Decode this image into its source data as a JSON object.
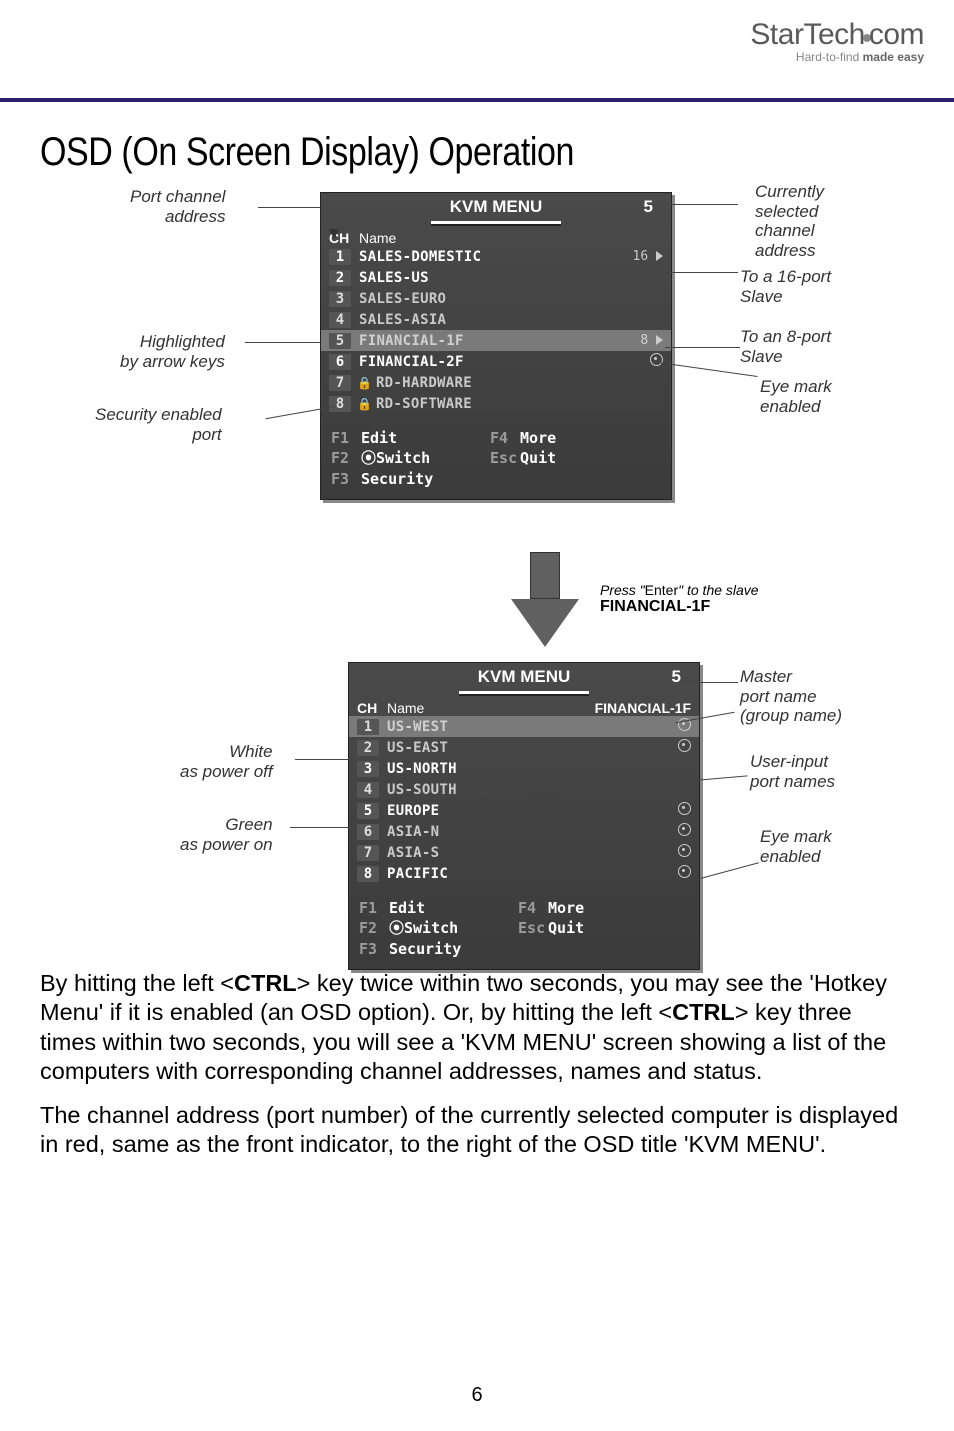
{
  "brand": {
    "name1": "StarTech",
    "name2": "com",
    "tag_pre": "Hard-to-find ",
    "tag_bold": "made easy"
  },
  "heading": "OSD (On Screen Display) Operation",
  "menu1": {
    "title": "KVM MENU",
    "current": "5",
    "ch_label": "CH",
    "name_label": "Name",
    "rows": [
      {
        "ch": "1",
        "name": "SALES-DOMESTIC",
        "ind": "16",
        "tri": true,
        "on": true
      },
      {
        "ch": "2",
        "name": "SALES-US",
        "on": true
      },
      {
        "ch": "3",
        "name": "SALES-EURO"
      },
      {
        "ch": "4",
        "name": "SALES-ASIA"
      },
      {
        "ch": "5",
        "name": "FINANCIAL-1F",
        "ind": "8",
        "tri": true,
        "hl": true
      },
      {
        "ch": "6",
        "name": "FINANCIAL-2F",
        "eye": true,
        "on": true
      },
      {
        "ch": "7",
        "name": "RD-HARDWARE",
        "lock": true
      },
      {
        "ch": "8",
        "name": "RD-SOFTWARE",
        "lock": true
      }
    ],
    "foot": {
      "f1": "F1",
      "f1l": "Edit",
      "f2": "F2",
      "f2l": "⦿Switch",
      "f3": "F3",
      "f3l": "Security",
      "f4": "F4",
      "f4l": "More",
      "esc": "Esc",
      "escl": "Quit"
    }
  },
  "menu2": {
    "title": "KVM MENU",
    "current": "5",
    "ch_label": "CH",
    "name_label": "Name",
    "group": "FINANCIAL-1F",
    "rows": [
      {
        "ch": "1",
        "name": "US-WEST",
        "eye": true,
        "hl": true
      },
      {
        "ch": "2",
        "name": "US-EAST",
        "eye": true
      },
      {
        "ch": "3",
        "name": "US-NORTH",
        "on": true
      },
      {
        "ch": "4",
        "name": "US-SOUTH"
      },
      {
        "ch": "5",
        "name": "EUROPE",
        "eye": true,
        "on": true
      },
      {
        "ch": "6",
        "name": "ASIA-N",
        "eye": true
      },
      {
        "ch": "7",
        "name": "ASIA-S",
        "eye": true
      },
      {
        "ch": "8",
        "name": "PACIFIC",
        "eye": true,
        "on": true
      }
    ],
    "foot": {
      "f1": "F1",
      "f1l": "Edit",
      "f2": "F2",
      "f2l": "⦿Switch",
      "f3": "F3",
      "f3l": "Security",
      "f4": "F4",
      "f4l": "More",
      "esc": "Esc",
      "escl": "Quit"
    }
  },
  "callouts": {
    "port_channel": "Port channel\naddress",
    "highlighted": "Highlighted\nby arrow keys",
    "security": "Security enabled\nport",
    "current_sel": "Currently\nselected\nchannel\naddress",
    "to16": "To a 16-port\nSlave",
    "to8": "To an 8-port\nSlave",
    "eyemark1": "Eye mark\nenabled",
    "enter_pre": "Press \"",
    "enter_key": "Enter",
    "enter_post": "\" to the slave",
    "enter_target": "FINANCIAL-1F",
    "master": "Master\nport name\n(group name)",
    "white": "White\nas power off",
    "green": "Green\nas power on",
    "userinput": "User-input\nport names",
    "eyemark2": "Eye mark\nenabled"
  },
  "para1_a": "By hitting the left <",
  "para1_b": "CTRL",
  "para1_c": "> key twice within two seconds, you may see the 'Hotkey Menu' if it is enabled (an OSD option). Or, by hitting the left <",
  "para1_d": "CTRL",
  "para1_e": "> key three times within two seconds, you will see a 'KVM MENU' screen showing a list of the computers with corresponding channel addresses, names and status.",
  "para2": "The channel address (port number) of the currently selected computer is displayed in red, same as the front indicator, to the right of the OSD title 'KVM MENU'.",
  "page_number": "6"
}
